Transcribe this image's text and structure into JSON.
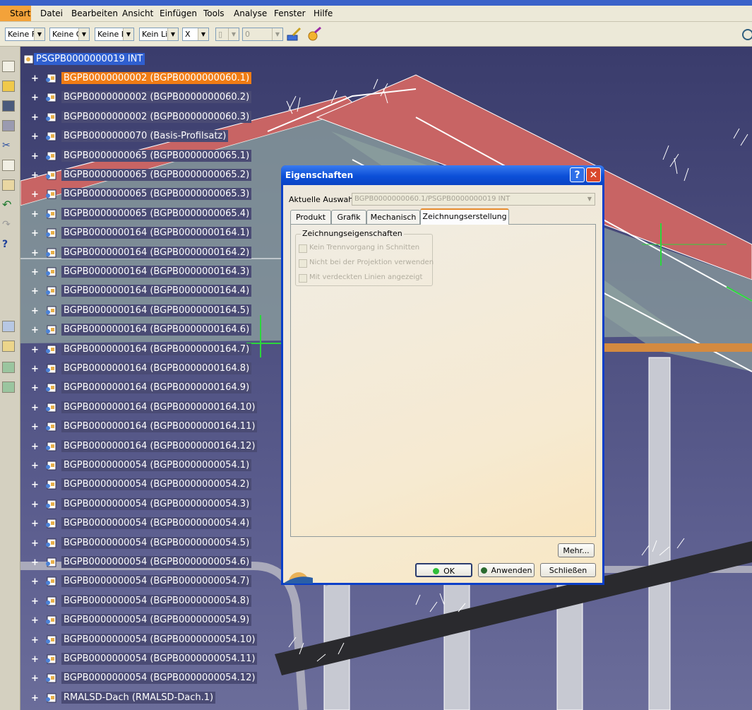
{
  "menu": {
    "items": [
      "Start",
      "Datei",
      "Bearbeiten",
      "Ansicht",
      "Einfügen",
      "Tools",
      "Analyse",
      "Fenster",
      "Hilfe"
    ]
  },
  "toolbar": {
    "combos": [
      "Keine F",
      "Keine O",
      "Keine B",
      "Kein Lin"
    ],
    "x_combo": "X",
    "num_field": "0"
  },
  "tree": {
    "root": "PSGPB0000000019 INT",
    "nodes": [
      "BGPB0000000002 (BGPB0000000060.1)",
      "BGPB0000000002 (BGPB0000000060.2)",
      "BGPB0000000002 (BGPB0000000060.3)",
      "BGPB0000000070 (Basis-Profilsatz)",
      "BGPB0000000065 (BGPB0000000065.1)",
      "BGPB0000000065 (BGPB0000000065.2)",
      "BGPB0000000065 (BGPB0000000065.3)",
      "BGPB0000000065 (BGPB0000000065.4)",
      "BGPB0000000164 (BGPB0000000164.1)",
      "BGPB0000000164 (BGPB0000000164.2)",
      "BGPB0000000164 (BGPB0000000164.3)",
      "BGPB0000000164 (BGPB0000000164.4)",
      "BGPB0000000164 (BGPB0000000164.5)",
      "BGPB0000000164 (BGPB0000000164.6)",
      "BGPB0000000164 (BGPB0000000164.7)",
      "BGPB0000000164 (BGPB0000000164.8)",
      "BGPB0000000164 (BGPB0000000164.9)",
      "BGPB0000000164 (BGPB0000000164.10)",
      "BGPB0000000164 (BGPB0000000164.11)",
      "BGPB0000000164 (BGPB0000000164.12)",
      "BGPB0000000054 (BGPB0000000054.1)",
      "BGPB0000000054 (BGPB0000000054.2)",
      "BGPB0000000054 (BGPB0000000054.3)",
      "BGPB0000000054 (BGPB0000000054.4)",
      "BGPB0000000054 (BGPB0000000054.5)",
      "BGPB0000000054 (BGPB0000000054.6)",
      "BGPB0000000054 (BGPB0000000054.7)",
      "BGPB0000000054 (BGPB0000000054.8)",
      "BGPB0000000054 (BGPB0000000054.9)",
      "BGPB0000000054 (BGPB0000000054.10)",
      "BGPB0000000054 (BGPB0000000054.11)",
      "BGPB0000000054 (BGPB0000000054.12)",
      "RMALSD-Dach (RMALSD-Dach.1)"
    ],
    "selected_index": 0
  },
  "dialog": {
    "title": "Eigenschaften",
    "help": "?",
    "close": "✕",
    "selection_label": "Aktuelle Auswahl:",
    "selection_value": "BGPB0000000060.1/PSGPB0000000019 INT",
    "tabs": [
      "Produkt",
      "Grafik",
      "Mechanisch",
      "Zeichnungserstellung"
    ],
    "active_tab": "Zeichnungserstellung",
    "group_title": "Zeichnungseigenschaften",
    "checkboxes": [
      "Kein Trennvorgang in Schnitten",
      "Nicht bei der Projektion verwenden",
      "Mit verdeckten Linien angezeigt"
    ],
    "more_button": "Mehr...",
    "ok_button": "OK",
    "apply_button": "Anwenden",
    "close_button": "Schließen"
  },
  "colors": {
    "selection_orange": "#f07c14",
    "root_highlight": "#2f5fd0",
    "dialog_titlebar": "#0b4fd8",
    "roof_red": "#c86464",
    "viewport_bg": "#3d3f72"
  }
}
